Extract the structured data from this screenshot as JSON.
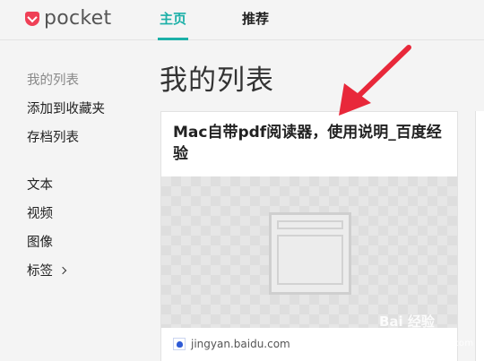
{
  "app": {
    "logo_text": "pocket"
  },
  "nav": {
    "home": "主页",
    "recommend": "推荐"
  },
  "sidebar": {
    "items": [
      {
        "label": "我的列表"
      },
      {
        "label": "添加到收藏夹"
      },
      {
        "label": "存档列表"
      },
      {
        "label": "文本"
      },
      {
        "label": "视频"
      },
      {
        "label": "图像"
      },
      {
        "label": "标签"
      }
    ]
  },
  "main": {
    "title": "我的列表",
    "card": {
      "title": "Mac自带pdf阅读器，使用说明_百度经验",
      "source": "jingyan.baidu.com"
    }
  },
  "watermark": {
    "brand": "Bai 经验",
    "url": "jingyan.baidu.com"
  },
  "colors": {
    "accent": "#1cb0a8",
    "brand": "#ef4056",
    "arrow": "#e8283a"
  }
}
